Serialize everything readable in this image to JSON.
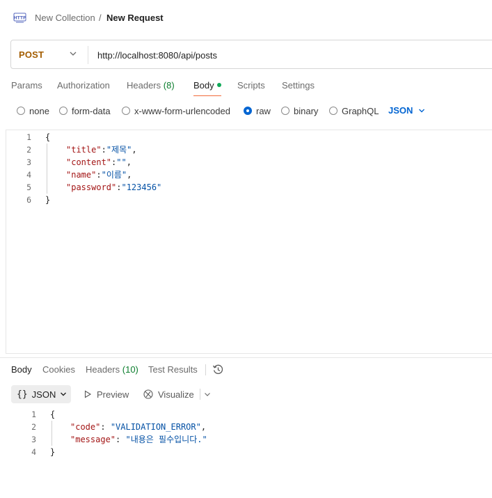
{
  "breadcrumb": {
    "icon": "http-icon",
    "parent": "New Collection",
    "separator": "/",
    "current": "New Request"
  },
  "request": {
    "method": "POST",
    "method_color": "#a35d00",
    "url": "http://localhost:8080/api/posts"
  },
  "request_tabs": [
    {
      "label": "Params"
    },
    {
      "label": "Authorization"
    },
    {
      "label": "Headers",
      "count": "(8)"
    },
    {
      "label": "Body",
      "active": true,
      "indicator": "green-dot"
    },
    {
      "label": "Scripts"
    },
    {
      "label": "Settings"
    }
  ],
  "body_types": {
    "options": [
      "none",
      "form-data",
      "x-www-form-urlencoded",
      "raw",
      "binary",
      "GraphQL"
    ],
    "selected": "raw",
    "format": "JSON",
    "accent_color": "#0265d2"
  },
  "request_body": {
    "line_numbers": [
      "1",
      "2",
      "3",
      "4",
      "5",
      "6"
    ],
    "open_brace": "{",
    "close_brace": "}",
    "fields": [
      {
        "key": "\"title\"",
        "value": "\"제목\"",
        "trail": ","
      },
      {
        "key": "\"content\"",
        "value": "\"\"",
        "trail": ","
      },
      {
        "key": "\"name\"",
        "value": "\"이름\"",
        "trail": ","
      },
      {
        "key": "\"password\"",
        "value": "\"123456\"",
        "trail": ""
      }
    ]
  },
  "response_tabs": [
    {
      "label": "Body",
      "active": true
    },
    {
      "label": "Cookies"
    },
    {
      "label": "Headers",
      "count": "(10)"
    },
    {
      "label": "Test Results"
    }
  ],
  "response_toolbar": {
    "format_braces": "{}",
    "format_label": "JSON",
    "preview_label": "Preview",
    "visualize_label": "Visualize"
  },
  "response_body": {
    "line_numbers": [
      "1",
      "2",
      "3",
      "4"
    ],
    "open_brace": "{",
    "close_brace": "}",
    "fields": [
      {
        "key": "\"code\"",
        "value": "\"VALIDATION_ERROR\"",
        "trail": ","
      },
      {
        "key": "\"message\"",
        "value": "\"내용은 필수입니다.\"",
        "trail": ""
      }
    ]
  }
}
